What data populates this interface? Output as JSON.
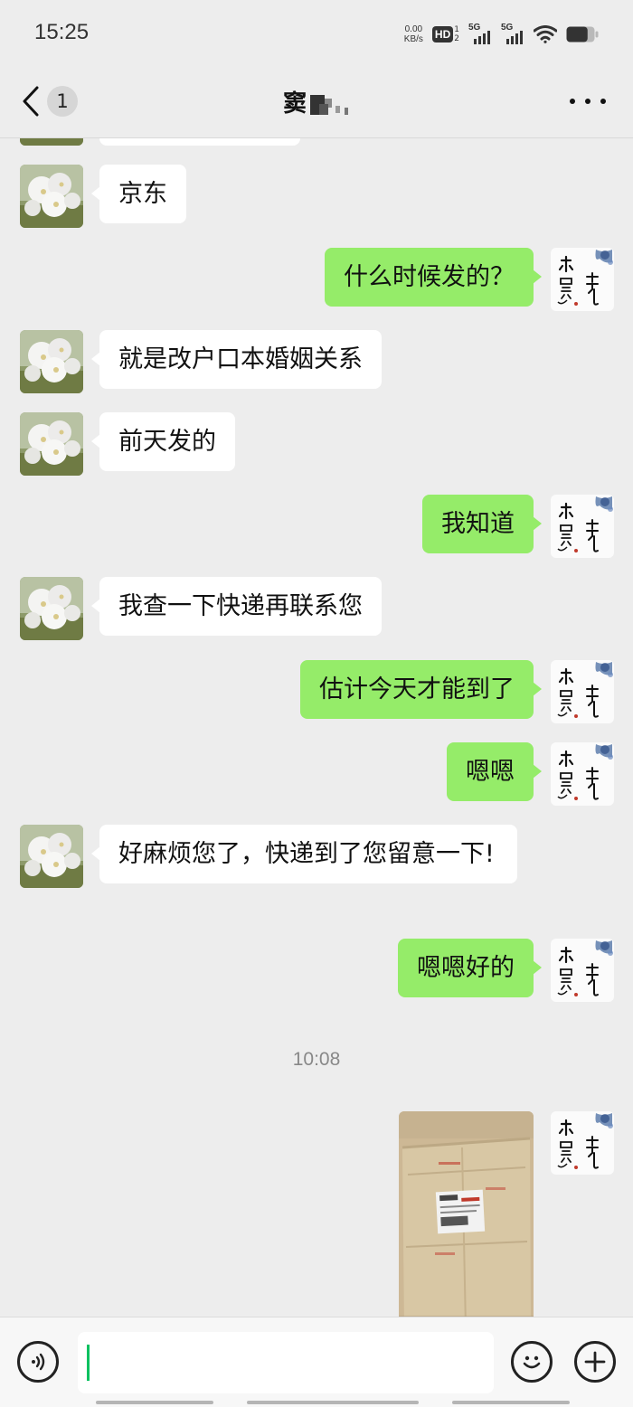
{
  "status_bar": {
    "time": "15:25",
    "net_speed_value": "0.00",
    "net_speed_unit": "KB/s",
    "hd_label": "HD",
    "hd_sub_top": "1",
    "hd_sub_bottom": "2",
    "sim1_label": "5G",
    "sim2_label": "5G",
    "battery_level": 0.75
  },
  "header": {
    "unread_count": "1",
    "contact_name": "窦"
  },
  "messages": [
    {
      "side": "left",
      "text": "京东"
    },
    {
      "side": "right",
      "text": "什么时候发的？"
    },
    {
      "side": "left",
      "text": "就是改户口本婚姻关系"
    },
    {
      "side": "left",
      "text": "前天发的"
    },
    {
      "side": "right",
      "text": "我知道"
    },
    {
      "side": "left",
      "text": "我查一下快递再联系您"
    },
    {
      "side": "right",
      "text": "估计今天才能到了"
    },
    {
      "side": "right",
      "text": "嗯嗯"
    },
    {
      "side": "left",
      "text": "好麻烦您了，快递到了您留意一下!"
    },
    {
      "side": "right",
      "text": "嗯嗯好的"
    }
  ],
  "timestamp": "10:08",
  "colors": {
    "background": "#ededed",
    "sent_bubble": "#95ec69",
    "received_bubble": "#ffffff",
    "caret": "#07c160"
  }
}
